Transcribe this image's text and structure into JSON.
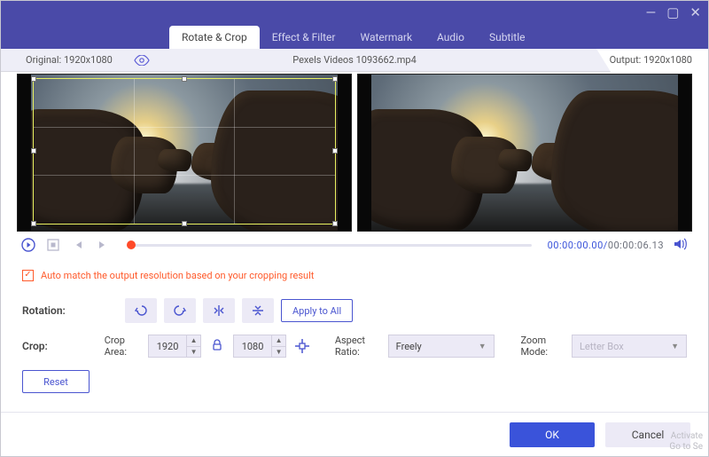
{
  "window": {
    "minimize": "—",
    "maximize": "▢",
    "close": "✕"
  },
  "tabs": [
    "Rotate & Crop",
    "Effect & Filter",
    "Watermark",
    "Audio",
    "Subtitle"
  ],
  "info": {
    "original_label": "Original:",
    "original_res": "1920x1080",
    "filename": "Pexels Videos 1093662.mp4",
    "output_label": "Output:",
    "output_res": "1920x1080"
  },
  "transport": {
    "current": "00:00:00.00",
    "duration": "00:00:06.13"
  },
  "automatch": {
    "checked": true,
    "label": "Auto match the output resolution based on your cropping result"
  },
  "rotation": {
    "label": "Rotation:",
    "apply_all": "Apply to All"
  },
  "crop": {
    "label": "Crop:",
    "area_label": "Crop Area:",
    "width": "1920",
    "height": "1080",
    "aspect_label": "Aspect Ratio:",
    "aspect_value": "Freely",
    "zoom_label": "Zoom Mode:",
    "zoom_value": "Letter Box",
    "reset": "Reset"
  },
  "footer": {
    "ok": "OK",
    "cancel": "Cancel"
  },
  "watermark": {
    "line1": "Activate",
    "line2": "Go to Se"
  },
  "colors": {
    "accent": "#3a53da",
    "titlebar": "#4a4aa8",
    "orange": "#ff5a2b"
  }
}
